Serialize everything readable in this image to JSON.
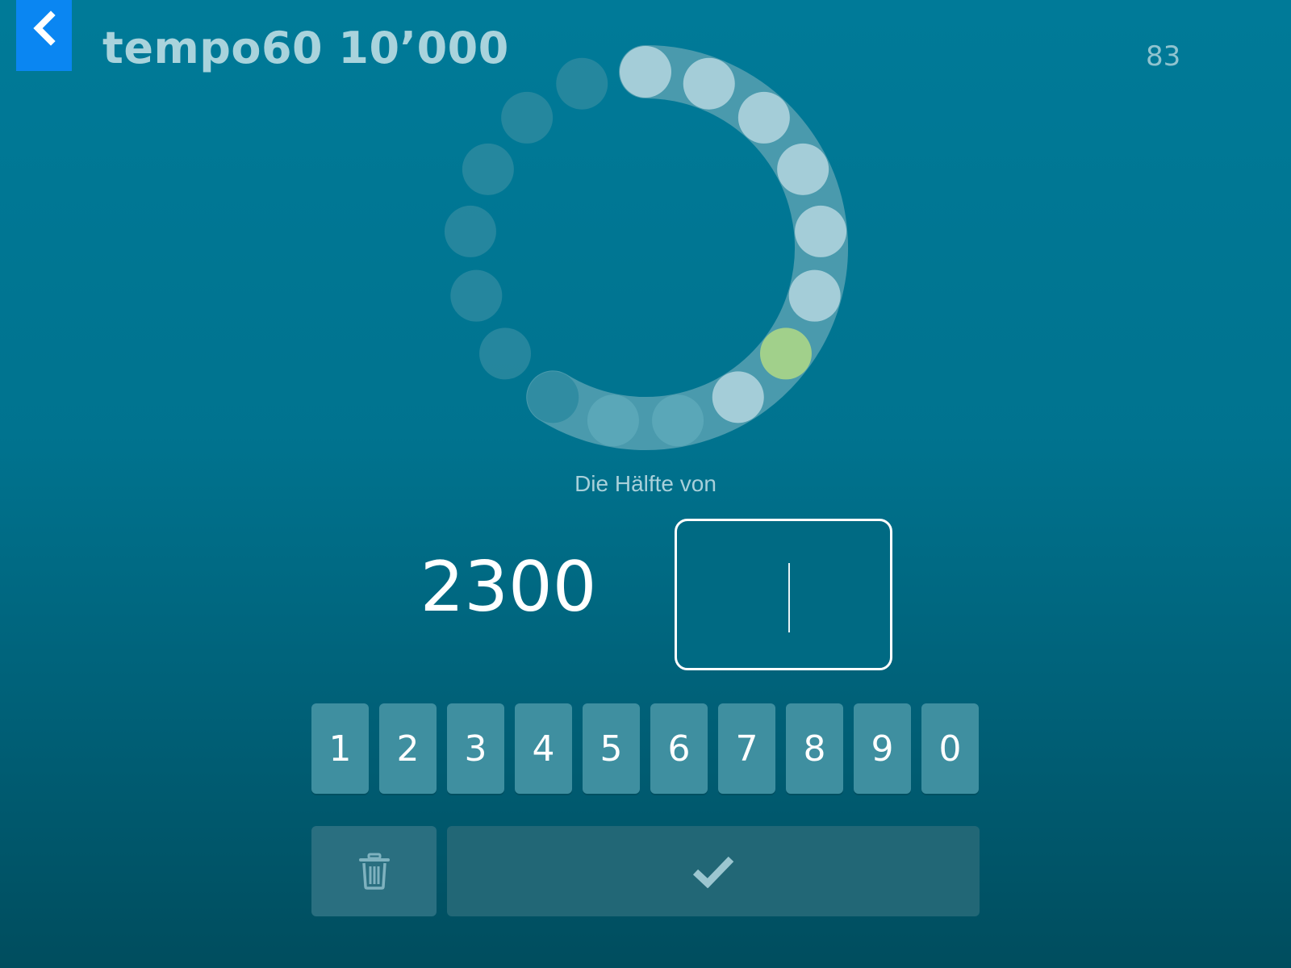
{
  "header": {
    "title": "tempo60 10’000",
    "counter": "83",
    "back_icon": "chevron-left-icon"
  },
  "progress": {
    "total_steps": 17,
    "completed_steps": 10,
    "current_step": 6,
    "colors": {
      "done": "#a4cdd8",
      "current": "#a1d08b",
      "pending": "#2b8aa0",
      "track": "#4a9aad"
    }
  },
  "task": {
    "prompt": "Die Hälfte von",
    "number": "2300"
  },
  "answer": {
    "value": ""
  },
  "keypad": {
    "keys": [
      "1",
      "2",
      "3",
      "4",
      "5",
      "6",
      "7",
      "8",
      "9",
      "0"
    ],
    "delete_icon": "trash-icon",
    "submit_icon": "checkmark-icon"
  },
  "colors": {
    "accent": "#0a86f2",
    "key": "#3f8fa0",
    "background_top": "#007a98",
    "background_bottom": "#004d5e"
  }
}
